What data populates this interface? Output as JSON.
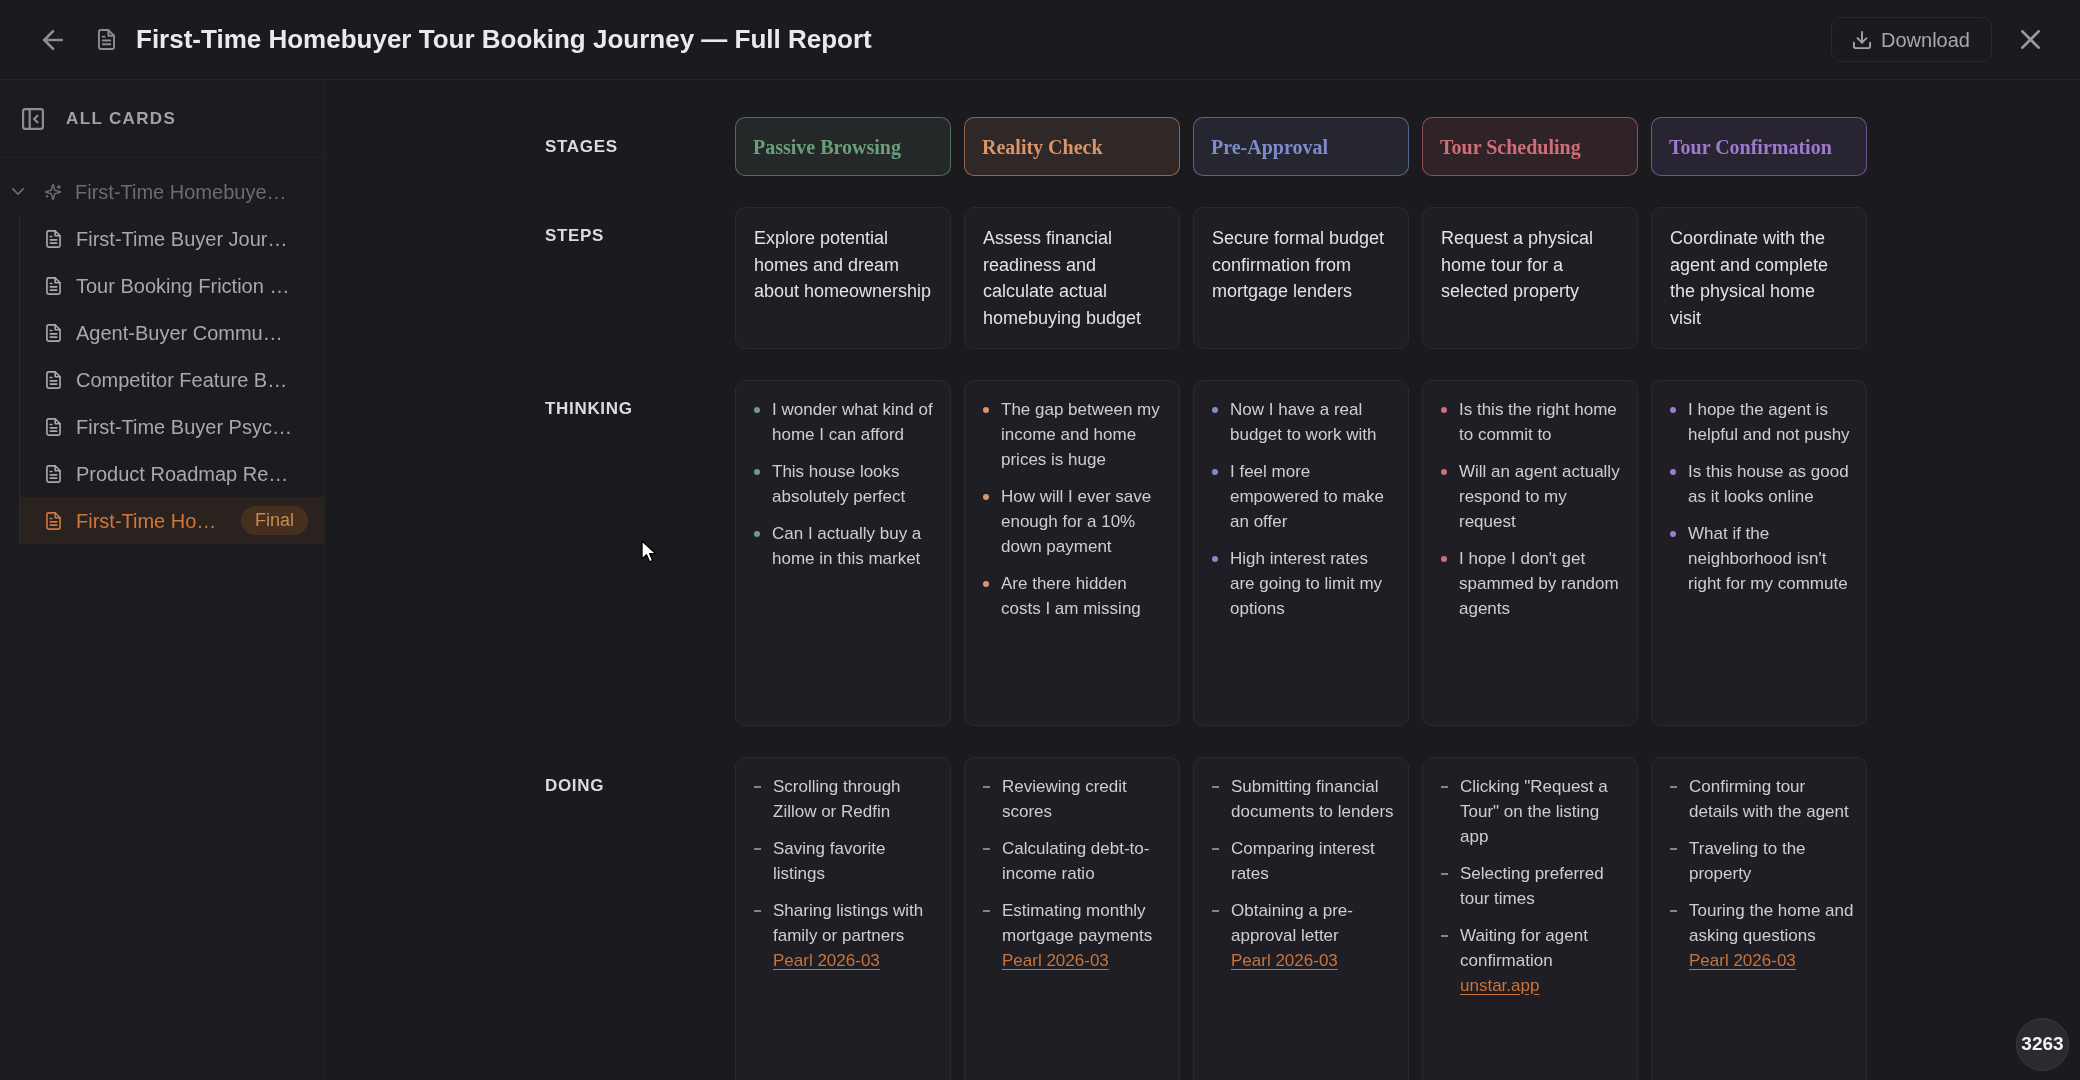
{
  "header": {
    "title": "First-Time Homebuyer Tour Booking Journey — Full Report",
    "download_label": "Download"
  },
  "sidebar": {
    "heading": "ALL CARDS",
    "tree": [
      {
        "label": "First-Time Homebuye…",
        "expanded": true,
        "children": [
          {
            "label": "First-Time Buyer Jour…",
            "selected": false
          },
          {
            "label": "Tour Booking Friction …",
            "selected": false
          },
          {
            "label": "Agent-Buyer Commu…",
            "selected": false
          },
          {
            "label": "Competitor Feature B…",
            "selected": false
          },
          {
            "label": "First-Time Buyer Psyc…",
            "selected": false
          },
          {
            "label": "Product Roadmap Re…",
            "selected": false
          },
          {
            "label": "First-Time Ho…",
            "selected": true,
            "badge": "Final"
          }
        ]
      }
    ]
  },
  "journey": {
    "labels": {
      "stages": "STAGES",
      "steps": "STEPS",
      "thinking": "THINKING",
      "doing": "DOING"
    },
    "stages": [
      {
        "name": "Passive Browsing",
        "color": "#6b9e7b",
        "step": "Explore potential homes and dream about homeownership",
        "thinking": [
          "I wonder what kind of home I can afford",
          "This house looks absolutely perfect",
          "Can I actually buy a home in this market"
        ],
        "doing": [
          {
            "text": "Scrolling through Zillow or Redfin"
          },
          {
            "text": "Saving favorite listings"
          },
          {
            "text": "Sharing listings with family or partners",
            "link": "Pearl 2026-03"
          }
        ]
      },
      {
        "name": "Reality Check",
        "color": "#d9956a",
        "step": "Assess financial readiness and calculate actual homebuying budget",
        "thinking": [
          "The gap between my income and home prices is huge",
          "How will I ever save enough for a 10% down payment",
          "Are there hidden costs I am missing"
        ],
        "doing": [
          {
            "text": "Reviewing credit scores"
          },
          {
            "text": "Calculating debt-to-income ratio"
          },
          {
            "text": "Estimating monthly mortgage payments",
            "link": "Pearl 2026-03"
          }
        ]
      },
      {
        "name": "Pre-Approval",
        "color": "#7d8dcc",
        "step": "Secure formal budget confirmation from mortgage lenders",
        "thinking": [
          "Now I have a real budget to work with",
          "I feel more empowered to make an offer",
          "High interest rates are going to limit my options"
        ],
        "doing": [
          {
            "text": "Submitting financial documents to lenders"
          },
          {
            "text": "Comparing interest rates"
          },
          {
            "text": "Obtaining a pre-approval letter",
            "link": "Pearl 2026-03"
          }
        ]
      },
      {
        "name": "Tour Scheduling",
        "color": "#cf6e79",
        "step": "Request a physical home tour for a selected property",
        "thinking": [
          "Is this the right home to commit to",
          "Will an agent actually respond to my request",
          "I hope I don't get spammed by random agents"
        ],
        "doing": [
          {
            "text": "Clicking \"Request a Tour\" on the listing app"
          },
          {
            "text": "Selecting preferred tour times"
          },
          {
            "text": "Waiting for agent confirmation",
            "link": "unstar.app"
          }
        ]
      },
      {
        "name": "Tour Confirmation",
        "color": "#9e79cc",
        "step": "Coordinate with the agent and complete the physical home visit",
        "thinking": [
          "I hope the agent is helpful and not pushy",
          "Is this house as good as it looks online",
          "What if the neighborhood isn't right for my commute"
        ],
        "doing": [
          {
            "text": "Confirming tour details with the agent"
          },
          {
            "text": "Traveling to the property"
          },
          {
            "text": "Touring the home and asking questions",
            "link": "Pearl 2026-03"
          }
        ]
      }
    ]
  },
  "counter": "3263"
}
